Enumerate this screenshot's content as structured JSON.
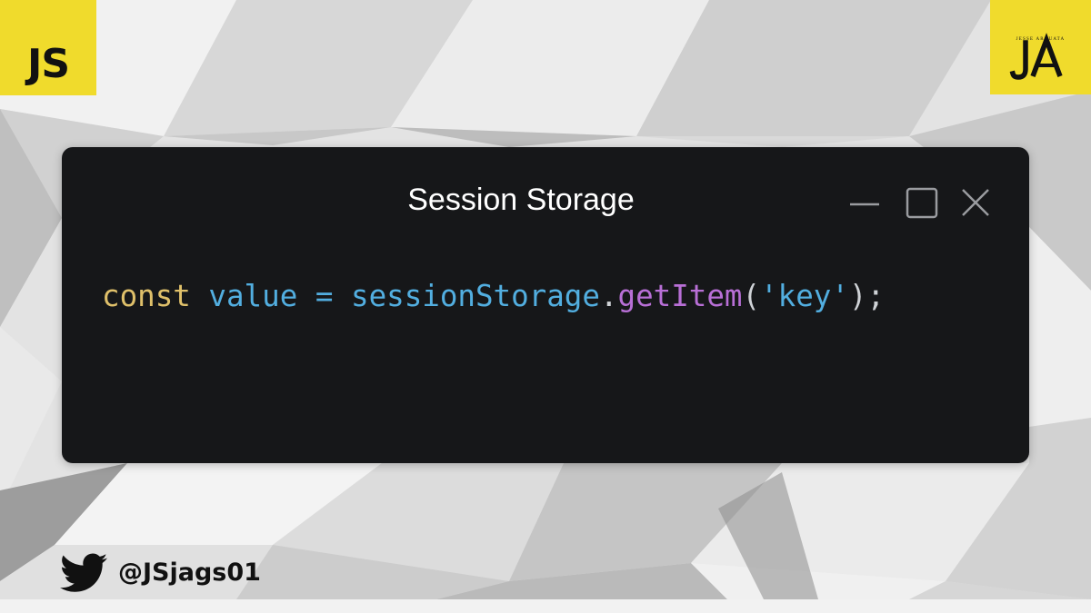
{
  "badge": {
    "label": "JS",
    "color": "#f0db2c"
  },
  "logo": {
    "name": "jesse-arguata-logo",
    "monogram": "JA",
    "caption": "JESSE ARGUATA"
  },
  "window": {
    "title": "Session Storage",
    "background": "#161719",
    "controls": [
      "minimize-icon",
      "maximize-icon",
      "close-icon"
    ]
  },
  "code": {
    "tokens": {
      "keyword": "const",
      "variable": "value",
      "operator": "=",
      "object": "sessionStorage",
      "dot": ".",
      "method": "getItem",
      "open_paren": "(",
      "string": "'key'",
      "close": ");"
    },
    "colors": {
      "keyword": "#dfc06a",
      "identifier": "#52aee0",
      "method": "#b86fd6",
      "punctuation": "#cfd2d6"
    }
  },
  "social": {
    "icon": "twitter-bird-icon",
    "handle": "@JSjags01"
  }
}
